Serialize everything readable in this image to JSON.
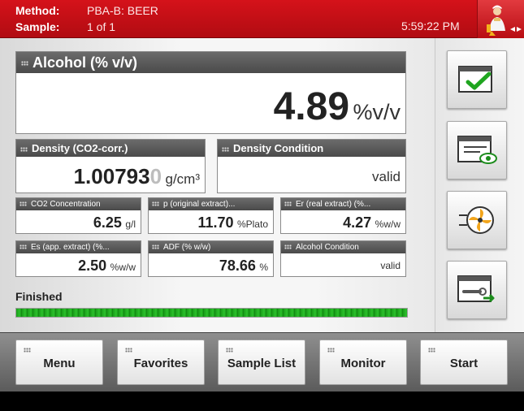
{
  "header": {
    "method_label": "Method:",
    "method_value": "PBA-B: BEER",
    "sample_label": "Sample:",
    "sample_value": "1 of 1",
    "time": "5:59:22 PM"
  },
  "main_result": {
    "title": "Alcohol (% v/v)",
    "value": "4.89",
    "unit": "%v/v"
  },
  "density": {
    "title": "Density (CO2-corr.)",
    "value": "1.00793",
    "value_ghost": "0",
    "unit": "g/cm³"
  },
  "density_condition": {
    "title": "Density Condition",
    "value": "valid"
  },
  "small_results": [
    {
      "title": "CO2 Concentration",
      "value": "6.25",
      "unit": "g/l"
    },
    {
      "title": "p (original extract)...",
      "value": "11.70",
      "unit": "%Plato"
    },
    {
      "title": "Er (real extract) (%...",
      "value": "4.27",
      "unit": "%w/w"
    },
    {
      "title": "Es (app. extract) (%...",
      "value": "2.50",
      "unit": "%w/w"
    },
    {
      "title": "ADF (% w/w)",
      "value": "78.66",
      "unit": "%"
    },
    {
      "title": "Alcohol Condition",
      "value": "valid",
      "unit": ""
    }
  ],
  "progress": {
    "label": "Finished",
    "fraction": 1.0
  },
  "bottom_buttons": [
    "Menu",
    "Favorites",
    "Sample List",
    "Monitor",
    "Start"
  ],
  "icons": {
    "user": "user-icon",
    "check": "check-icon",
    "view": "view-icon",
    "fan": "fan-icon",
    "tool": "tool-icon"
  },
  "colors": {
    "header": "#c80f16",
    "progress": "#1fae1f"
  }
}
